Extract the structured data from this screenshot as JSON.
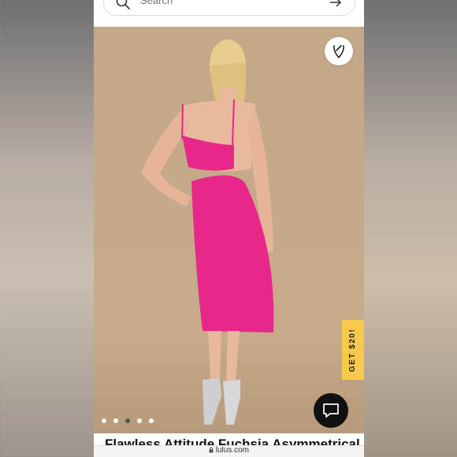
{
  "search": {
    "placeholder": "Search"
  },
  "promo": {
    "label": "GET $20!"
  },
  "carousel": {
    "dot_count": 5,
    "active_index": 2
  },
  "product": {
    "title": "Flawless Attitude Fuchsia Asymmetrical"
  },
  "browser": {
    "url": "lulus.com"
  },
  "colors": {
    "accent_promo": "#f7c94d",
    "dress": "#e8278a",
    "chat_bg": "#111111"
  },
  "icons": {
    "search": "search-icon",
    "arrow": "arrow-right-icon",
    "wishlist": "heart-icon",
    "chat": "chat-bubble-icon",
    "lock": "lock-icon"
  }
}
